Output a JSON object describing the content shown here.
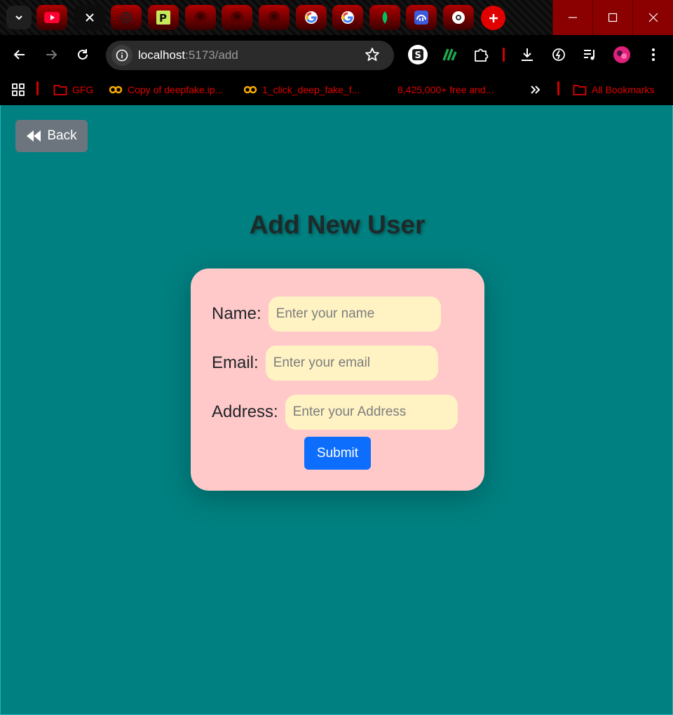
{
  "browser": {
    "tabs": [
      {
        "icon": "youtube-icon"
      },
      {
        "icon": "close-icon",
        "active": true
      },
      {
        "icon": "openai-icon"
      },
      {
        "icon": "p-logo-icon"
      },
      {
        "icon": "github-icon"
      },
      {
        "icon": "github-icon"
      },
      {
        "icon": "github-icon"
      },
      {
        "icon": "google-icon"
      },
      {
        "icon": "google-icon"
      },
      {
        "icon": "mongodb-leaf-icon"
      },
      {
        "icon": "dashboard-icon"
      },
      {
        "icon": "chrome-icon"
      }
    ],
    "address": {
      "host": "localhost",
      "path": ":5173/add"
    },
    "bookmarks": [
      {
        "label": "GFG",
        "icon": "folder-icon"
      },
      {
        "label": "Copy of deepfake.ip...",
        "icon": "colab-icon"
      },
      {
        "label": "1_click_deep_fake_f...",
        "icon": "colab-icon"
      },
      {
        "label": "8,425,000+ free and...",
        "icon": "none"
      },
      {
        "label": "All Bookmarks",
        "icon": "folder-icon"
      }
    ],
    "colors": {
      "accent": "#e00000",
      "tab_gradient_top": "#b00000"
    }
  },
  "page": {
    "back_label": "Back",
    "title": "Add New User",
    "form": {
      "name_label": "Name:",
      "name_placeholder": "Enter your name",
      "email_label": "Email:",
      "email_placeholder": "Enter your email",
      "address_label": "Address:",
      "address_placeholder": "Enter your Address",
      "submit_label": "Submit"
    },
    "colors": {
      "background": "#008080",
      "card": "#ffc9c9",
      "input": "#fff3c4",
      "submit": "#0d6efd",
      "back": "#6c757d"
    }
  }
}
